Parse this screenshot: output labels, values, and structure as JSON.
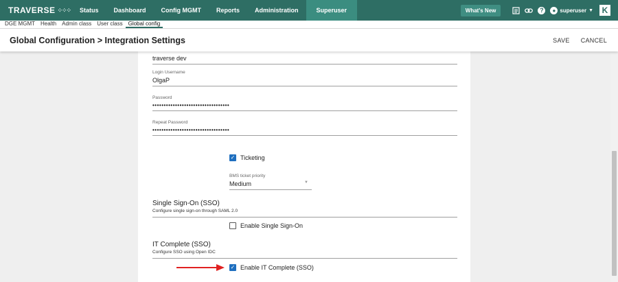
{
  "nav": {
    "logo": "TRAVERSE",
    "items": [
      "Status",
      "Dashboard",
      "Config MGMT",
      "Reports",
      "Administration",
      "Superuser"
    ],
    "whats_new": "What's New",
    "username": "superuser"
  },
  "subnav": {
    "items": [
      "DGE MGMT",
      "Health",
      "Admin class",
      "User class",
      "Global config"
    ]
  },
  "title": {
    "page_title": "Global Configuration > Integration Settings",
    "save": "SAVE",
    "cancel": "CANCEL"
  },
  "form": {
    "top_field_value": "traverse dev",
    "login_label": "Login Username",
    "login_value": "OlgaP",
    "password_label": "Password",
    "password_value": "••••••••••••••••••••••••••••••••••",
    "repeat_label": "Repeat Password",
    "repeat_value": "••••••••••••••••••••••••••••••••••",
    "ticketing_label": "Ticketing",
    "ticket_priority_label": "BMS ticket priority",
    "ticket_priority_value": "Medium",
    "sso_title": "Single Sign-On (SSO)",
    "sso_desc": "Configure single sign-on through SAML 2.0",
    "sso_enable_label": "Enable Single Sign-On",
    "itc_title": "IT Complete (SSO)",
    "itc_desc": "Configure SSO using Open IDC",
    "itc_enable_label": "Enable IT Complete (SSO)"
  },
  "colors": {
    "nav_bg": "#2e6e64",
    "nav_active": "#3b8d80",
    "checkbox": "#1f6fbf",
    "annotation_arrow": "#e02020"
  }
}
